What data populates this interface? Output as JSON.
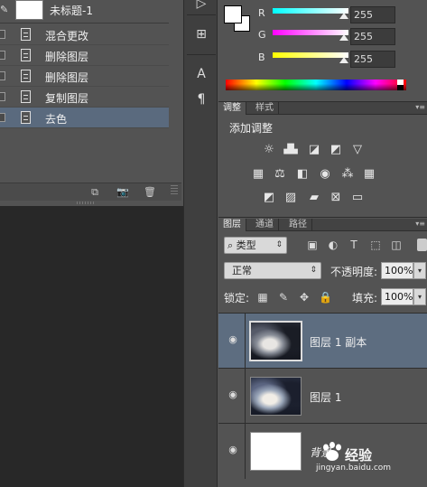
{
  "history": {
    "snapshot_label": "未标题-1",
    "items": [
      {
        "label": "混合更改"
      },
      {
        "label": "删除图层"
      },
      {
        "label": "删除图层"
      },
      {
        "label": "复制图层"
      },
      {
        "label": "去色"
      }
    ],
    "selected_index": 4
  },
  "color": {
    "channels": [
      {
        "label": "R",
        "value": "255",
        "gradient": [
          "#000000",
          "#ff0000"
        ]
      },
      {
        "label": "G",
        "value": "255",
        "gradient": [
          "#000000",
          "#00ff00"
        ]
      },
      {
        "label": "B",
        "value": "255",
        "gradient": [
          "#000000",
          "#0000ff"
        ]
      }
    ],
    "foreground": "#ffffff",
    "background": "#ffffff"
  },
  "adjustments": {
    "tabs": [
      "调整",
      "样式"
    ],
    "title": "添加调整",
    "icon_rows": [
      [
        "brightness-contrast-icon",
        "levels-icon",
        "curves-icon",
        "exposure-icon",
        "vibrance-icon"
      ],
      [
        "hue-saturation-icon",
        "color-balance-icon",
        "black-white-icon",
        "photo-filter-icon",
        "channel-mixer-icon",
        "color-lookup-icon"
      ],
      [
        "invert-icon",
        "posterize-icon",
        "threshold-icon",
        "selective-color-icon",
        "gradient-map-icon"
      ]
    ]
  },
  "layers": {
    "tabs": [
      "图层",
      "通道",
      "路径"
    ],
    "filter_label": "类型",
    "blend_mode": "正常",
    "opacity_label": "不透明度:",
    "opacity_value": "100%",
    "lock_label": "锁定:",
    "fill_label": "填充:",
    "fill_value": "100%",
    "items": [
      {
        "name": "图层 1 副本",
        "thumb": "photo",
        "selected": true
      },
      {
        "name": "图层 1",
        "thumb": "photo-color",
        "selected": false
      },
      {
        "name": "背景",
        "thumb": "white",
        "selected": false
      }
    ]
  },
  "watermark": {
    "text": "经验",
    "url": "jingyan.baidu.com"
  }
}
